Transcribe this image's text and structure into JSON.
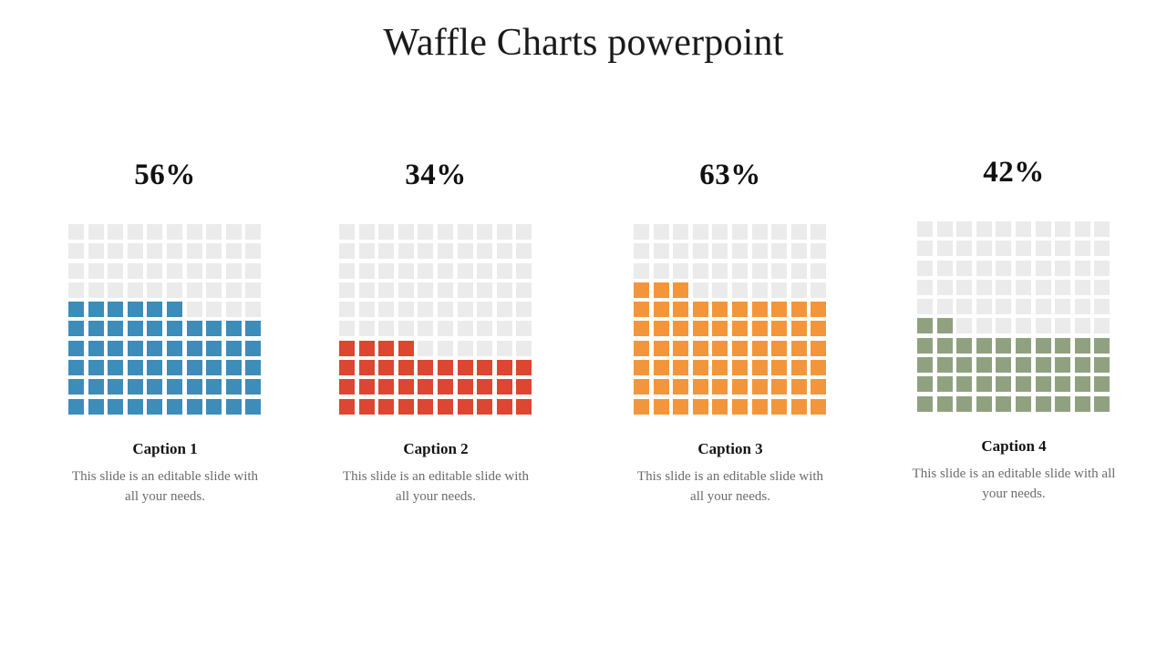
{
  "title": "Waffle Charts powerpoint",
  "colors": {
    "empty_cell": "#ebebeb",
    "text_dark": "#141414",
    "text_muted": "#6b6b6b",
    "background": "#ffffff"
  },
  "chart_data": [
    {
      "type": "waffle",
      "title": "Caption 1",
      "percent_label": "56%",
      "value": 56,
      "total": 100,
      "rows": 10,
      "columns": 10,
      "fill_color": "#3d8dba",
      "empty_color": "#ebebeb",
      "fill_direction": "bottom-up-left-to-right",
      "caption": "Caption 1",
      "description": "This slide is an editable slide with all your needs."
    },
    {
      "type": "waffle",
      "title": "Caption 2",
      "percent_label": "34%",
      "value": 34,
      "total": 100,
      "rows": 10,
      "columns": 10,
      "fill_color": "#dd4631",
      "empty_color": "#ebebeb",
      "fill_direction": "bottom-up-left-to-right",
      "caption": "Caption 2",
      "description": "This slide is an editable slide with all your needs."
    },
    {
      "type": "waffle",
      "title": "Caption 3",
      "percent_label": "63%",
      "value": 63,
      "total": 100,
      "rows": 10,
      "columns": 10,
      "fill_color": "#f3963b",
      "empty_color": "#ebebeb",
      "fill_direction": "bottom-up-left-to-right",
      "caption": "Caption 3",
      "description": "This slide is an editable slide with all your needs."
    },
    {
      "type": "waffle",
      "title": "Caption 4",
      "percent_label": "42%",
      "value": 42,
      "total": 100,
      "rows": 10,
      "columns": 10,
      "fill_color": "#90a180",
      "empty_color": "#ebebeb",
      "fill_direction": "bottom-up-left-to-right",
      "caption": "Caption 4",
      "description": "This slide is an editable slide with all your needs."
    }
  ]
}
